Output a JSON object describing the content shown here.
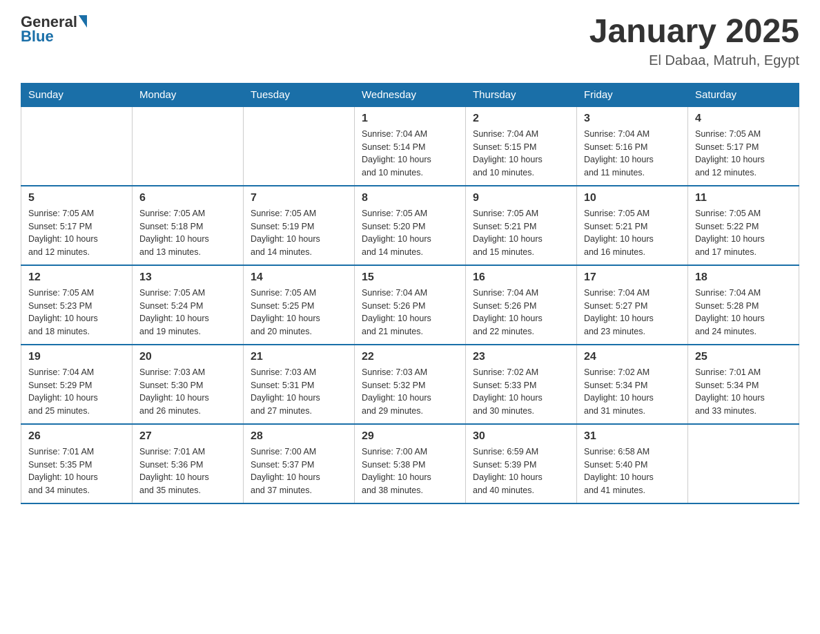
{
  "header": {
    "logo_general": "General",
    "logo_blue": "Blue",
    "title": "January 2025",
    "subtitle": "El Dabaa, Matruh, Egypt"
  },
  "days_of_week": [
    "Sunday",
    "Monday",
    "Tuesday",
    "Wednesday",
    "Thursday",
    "Friday",
    "Saturday"
  ],
  "weeks": [
    [
      {
        "day": "",
        "info": ""
      },
      {
        "day": "",
        "info": ""
      },
      {
        "day": "",
        "info": ""
      },
      {
        "day": "1",
        "info": "Sunrise: 7:04 AM\nSunset: 5:14 PM\nDaylight: 10 hours\nand 10 minutes."
      },
      {
        "day": "2",
        "info": "Sunrise: 7:04 AM\nSunset: 5:15 PM\nDaylight: 10 hours\nand 10 minutes."
      },
      {
        "day": "3",
        "info": "Sunrise: 7:04 AM\nSunset: 5:16 PM\nDaylight: 10 hours\nand 11 minutes."
      },
      {
        "day": "4",
        "info": "Sunrise: 7:05 AM\nSunset: 5:17 PM\nDaylight: 10 hours\nand 12 minutes."
      }
    ],
    [
      {
        "day": "5",
        "info": "Sunrise: 7:05 AM\nSunset: 5:17 PM\nDaylight: 10 hours\nand 12 minutes."
      },
      {
        "day": "6",
        "info": "Sunrise: 7:05 AM\nSunset: 5:18 PM\nDaylight: 10 hours\nand 13 minutes."
      },
      {
        "day": "7",
        "info": "Sunrise: 7:05 AM\nSunset: 5:19 PM\nDaylight: 10 hours\nand 14 minutes."
      },
      {
        "day": "8",
        "info": "Sunrise: 7:05 AM\nSunset: 5:20 PM\nDaylight: 10 hours\nand 14 minutes."
      },
      {
        "day": "9",
        "info": "Sunrise: 7:05 AM\nSunset: 5:21 PM\nDaylight: 10 hours\nand 15 minutes."
      },
      {
        "day": "10",
        "info": "Sunrise: 7:05 AM\nSunset: 5:21 PM\nDaylight: 10 hours\nand 16 minutes."
      },
      {
        "day": "11",
        "info": "Sunrise: 7:05 AM\nSunset: 5:22 PM\nDaylight: 10 hours\nand 17 minutes."
      }
    ],
    [
      {
        "day": "12",
        "info": "Sunrise: 7:05 AM\nSunset: 5:23 PM\nDaylight: 10 hours\nand 18 minutes."
      },
      {
        "day": "13",
        "info": "Sunrise: 7:05 AM\nSunset: 5:24 PM\nDaylight: 10 hours\nand 19 minutes."
      },
      {
        "day": "14",
        "info": "Sunrise: 7:05 AM\nSunset: 5:25 PM\nDaylight: 10 hours\nand 20 minutes."
      },
      {
        "day": "15",
        "info": "Sunrise: 7:04 AM\nSunset: 5:26 PM\nDaylight: 10 hours\nand 21 minutes."
      },
      {
        "day": "16",
        "info": "Sunrise: 7:04 AM\nSunset: 5:26 PM\nDaylight: 10 hours\nand 22 minutes."
      },
      {
        "day": "17",
        "info": "Sunrise: 7:04 AM\nSunset: 5:27 PM\nDaylight: 10 hours\nand 23 minutes."
      },
      {
        "day": "18",
        "info": "Sunrise: 7:04 AM\nSunset: 5:28 PM\nDaylight: 10 hours\nand 24 minutes."
      }
    ],
    [
      {
        "day": "19",
        "info": "Sunrise: 7:04 AM\nSunset: 5:29 PM\nDaylight: 10 hours\nand 25 minutes."
      },
      {
        "day": "20",
        "info": "Sunrise: 7:03 AM\nSunset: 5:30 PM\nDaylight: 10 hours\nand 26 minutes."
      },
      {
        "day": "21",
        "info": "Sunrise: 7:03 AM\nSunset: 5:31 PM\nDaylight: 10 hours\nand 27 minutes."
      },
      {
        "day": "22",
        "info": "Sunrise: 7:03 AM\nSunset: 5:32 PM\nDaylight: 10 hours\nand 29 minutes."
      },
      {
        "day": "23",
        "info": "Sunrise: 7:02 AM\nSunset: 5:33 PM\nDaylight: 10 hours\nand 30 minutes."
      },
      {
        "day": "24",
        "info": "Sunrise: 7:02 AM\nSunset: 5:34 PM\nDaylight: 10 hours\nand 31 minutes."
      },
      {
        "day": "25",
        "info": "Sunrise: 7:01 AM\nSunset: 5:34 PM\nDaylight: 10 hours\nand 33 minutes."
      }
    ],
    [
      {
        "day": "26",
        "info": "Sunrise: 7:01 AM\nSunset: 5:35 PM\nDaylight: 10 hours\nand 34 minutes."
      },
      {
        "day": "27",
        "info": "Sunrise: 7:01 AM\nSunset: 5:36 PM\nDaylight: 10 hours\nand 35 minutes."
      },
      {
        "day": "28",
        "info": "Sunrise: 7:00 AM\nSunset: 5:37 PM\nDaylight: 10 hours\nand 37 minutes."
      },
      {
        "day": "29",
        "info": "Sunrise: 7:00 AM\nSunset: 5:38 PM\nDaylight: 10 hours\nand 38 minutes."
      },
      {
        "day": "30",
        "info": "Sunrise: 6:59 AM\nSunset: 5:39 PM\nDaylight: 10 hours\nand 40 minutes."
      },
      {
        "day": "31",
        "info": "Sunrise: 6:58 AM\nSunset: 5:40 PM\nDaylight: 10 hours\nand 41 minutes."
      },
      {
        "day": "",
        "info": ""
      }
    ]
  ]
}
